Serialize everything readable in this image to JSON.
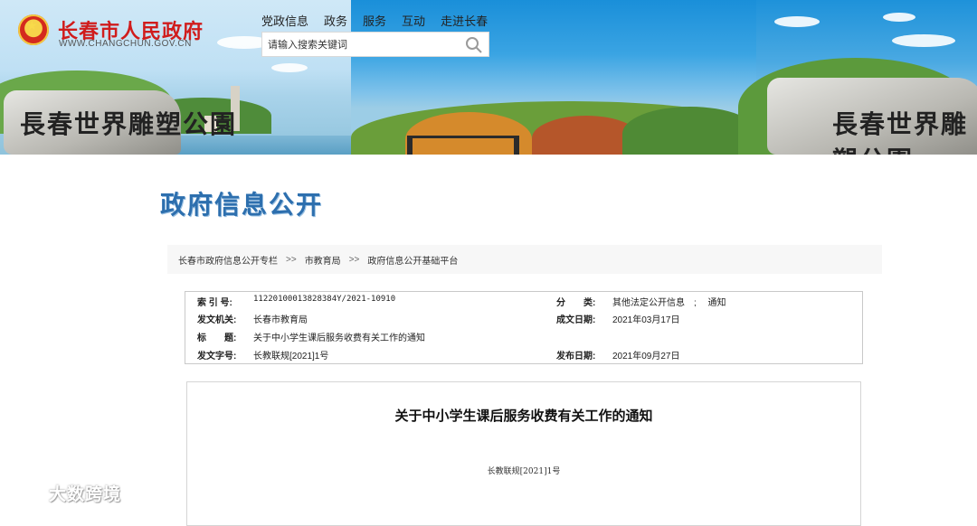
{
  "header": {
    "site_title": "长春市人民政府",
    "site_url": "WWW.CHANGCHUN.GOV.CN",
    "logo_icon": "national-emblem-icon",
    "banner_left_inscription": "長春世界雕塑公園",
    "banner_right_inscription": "長春世界雕塑公園",
    "nav": [
      "党政信息",
      "政务",
      "服务",
      "互动",
      "走进长春"
    ],
    "search": {
      "placeholder": "请输入搜索关键词",
      "icon": "search-icon"
    }
  },
  "page_title": "政府信息公开",
  "breadcrumb": {
    "items": [
      "长春市政府信息公开专栏",
      "市教育局",
      "政府信息公开基础平台"
    ],
    "separator": ">>"
  },
  "meta": {
    "index_label": "索 引 号:",
    "index_value": "11220100013828384Y/2021-10910",
    "category_label": "分　　类:",
    "category_value": "其他法定公开信息　;　 通知",
    "issuer_label": "发文机关:",
    "issuer_value": "长春市教育局",
    "date_written_label": "成文日期:",
    "date_written_value": "2021年03月17日",
    "title_label": "标　　题:",
    "title_value": "关于中小学生课后服务收费有关工作的通知",
    "doc_number_label": "发文字号:",
    "doc_number_value": "长教联规[2021]1号",
    "publish_date_label": "发布日期:",
    "publish_date_value": "2021年09月27日"
  },
  "document": {
    "title": "关于中小学生课后服务收费有关工作的通知",
    "number": "长教联规[2021]1号"
  },
  "watermark": {
    "text": "大数跨境",
    "icon": "brand-logo-icon"
  },
  "colors": {
    "site_title": "#d01c1c",
    "section_title": "#2d6fae",
    "breadcrumb_bg": "#f7f7f7",
    "border": "#c9c9c9"
  }
}
